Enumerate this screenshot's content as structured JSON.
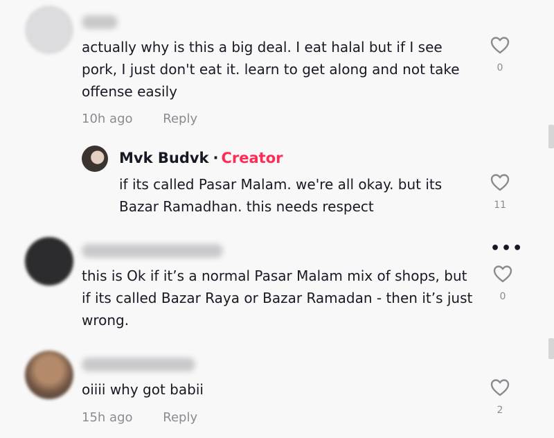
{
  "comments": [
    {
      "text": "actually why is this a big deal. I eat halal but if I see pork, I just don't eat it. learn to get along and not take offense easily",
      "time": "10h ago",
      "reply_label": "Reply",
      "likes": "0"
    },
    {
      "author": "Mvk Budvk",
      "separator": "·",
      "badge": "Creator",
      "text": "if its called Pasar Malam. we're all okay. but its Bazar Ramadhan. this needs respect",
      "likes": "11"
    },
    {
      "text": "this is Ok if it’s a normal Pasar Malam mix of shops, but if its called Bazar Raya or Bazar Ramadan - then it’s just wrong.",
      "more_label": "•••",
      "likes": "0"
    },
    {
      "text": "oiiii why got babii",
      "time": "15h ago",
      "reply_label": "Reply",
      "likes": "2"
    }
  ],
  "colors": {
    "background": "#f8f8f8",
    "text": "#161823",
    "muted": "#8a8b91",
    "creator_badge": "#fe2c55"
  },
  "icons": [
    "heart-outline-icon",
    "more-options-icon"
  ]
}
